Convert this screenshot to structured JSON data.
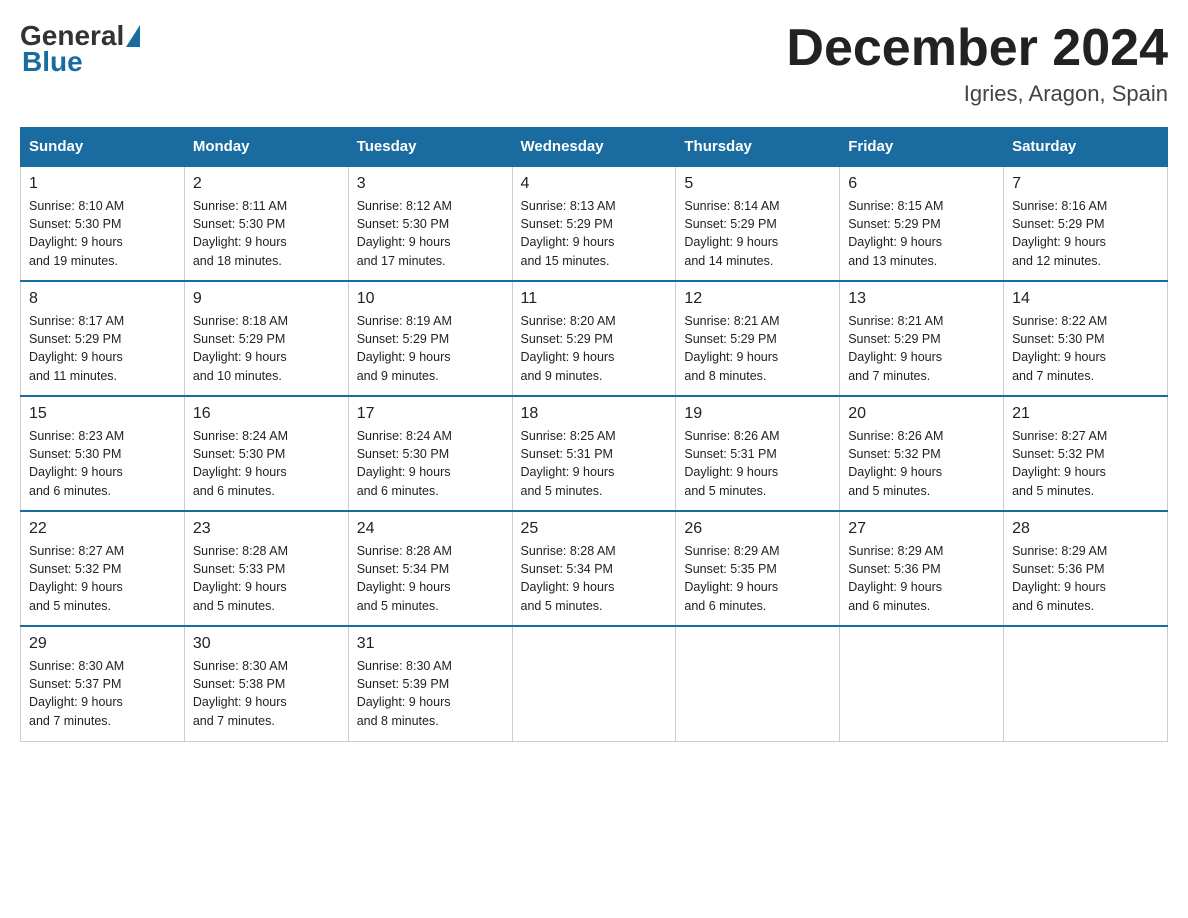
{
  "logo": {
    "general": "General",
    "blue": "Blue"
  },
  "header": {
    "month": "December 2024",
    "location": "Igries, Aragon, Spain"
  },
  "weekdays": [
    "Sunday",
    "Monday",
    "Tuesday",
    "Wednesday",
    "Thursday",
    "Friday",
    "Saturday"
  ],
  "weeks": [
    [
      {
        "day": "1",
        "sunrise": "8:10 AM",
        "sunset": "5:30 PM",
        "daylight": "9 hours and 19 minutes."
      },
      {
        "day": "2",
        "sunrise": "8:11 AM",
        "sunset": "5:30 PM",
        "daylight": "9 hours and 18 minutes."
      },
      {
        "day": "3",
        "sunrise": "8:12 AM",
        "sunset": "5:30 PM",
        "daylight": "9 hours and 17 minutes."
      },
      {
        "day": "4",
        "sunrise": "8:13 AM",
        "sunset": "5:29 PM",
        "daylight": "9 hours and 15 minutes."
      },
      {
        "day": "5",
        "sunrise": "8:14 AM",
        "sunset": "5:29 PM",
        "daylight": "9 hours and 14 minutes."
      },
      {
        "day": "6",
        "sunrise": "8:15 AM",
        "sunset": "5:29 PM",
        "daylight": "9 hours and 13 minutes."
      },
      {
        "day": "7",
        "sunrise": "8:16 AM",
        "sunset": "5:29 PM",
        "daylight": "9 hours and 12 minutes."
      }
    ],
    [
      {
        "day": "8",
        "sunrise": "8:17 AM",
        "sunset": "5:29 PM",
        "daylight": "9 hours and 11 minutes."
      },
      {
        "day": "9",
        "sunrise": "8:18 AM",
        "sunset": "5:29 PM",
        "daylight": "9 hours and 10 minutes."
      },
      {
        "day": "10",
        "sunrise": "8:19 AM",
        "sunset": "5:29 PM",
        "daylight": "9 hours and 9 minutes."
      },
      {
        "day": "11",
        "sunrise": "8:20 AM",
        "sunset": "5:29 PM",
        "daylight": "9 hours and 9 minutes."
      },
      {
        "day": "12",
        "sunrise": "8:21 AM",
        "sunset": "5:29 PM",
        "daylight": "9 hours and 8 minutes."
      },
      {
        "day": "13",
        "sunrise": "8:21 AM",
        "sunset": "5:29 PM",
        "daylight": "9 hours and 7 minutes."
      },
      {
        "day": "14",
        "sunrise": "8:22 AM",
        "sunset": "5:30 PM",
        "daylight": "9 hours and 7 minutes."
      }
    ],
    [
      {
        "day": "15",
        "sunrise": "8:23 AM",
        "sunset": "5:30 PM",
        "daylight": "9 hours and 6 minutes."
      },
      {
        "day": "16",
        "sunrise": "8:24 AM",
        "sunset": "5:30 PM",
        "daylight": "9 hours and 6 minutes."
      },
      {
        "day": "17",
        "sunrise": "8:24 AM",
        "sunset": "5:30 PM",
        "daylight": "9 hours and 6 minutes."
      },
      {
        "day": "18",
        "sunrise": "8:25 AM",
        "sunset": "5:31 PM",
        "daylight": "9 hours and 5 minutes."
      },
      {
        "day": "19",
        "sunrise": "8:26 AM",
        "sunset": "5:31 PM",
        "daylight": "9 hours and 5 minutes."
      },
      {
        "day": "20",
        "sunrise": "8:26 AM",
        "sunset": "5:32 PM",
        "daylight": "9 hours and 5 minutes."
      },
      {
        "day": "21",
        "sunrise": "8:27 AM",
        "sunset": "5:32 PM",
        "daylight": "9 hours and 5 minutes."
      }
    ],
    [
      {
        "day": "22",
        "sunrise": "8:27 AM",
        "sunset": "5:32 PM",
        "daylight": "9 hours and 5 minutes."
      },
      {
        "day": "23",
        "sunrise": "8:28 AM",
        "sunset": "5:33 PM",
        "daylight": "9 hours and 5 minutes."
      },
      {
        "day": "24",
        "sunrise": "8:28 AM",
        "sunset": "5:34 PM",
        "daylight": "9 hours and 5 minutes."
      },
      {
        "day": "25",
        "sunrise": "8:28 AM",
        "sunset": "5:34 PM",
        "daylight": "9 hours and 5 minutes."
      },
      {
        "day": "26",
        "sunrise": "8:29 AM",
        "sunset": "5:35 PM",
        "daylight": "9 hours and 6 minutes."
      },
      {
        "day": "27",
        "sunrise": "8:29 AM",
        "sunset": "5:36 PM",
        "daylight": "9 hours and 6 minutes."
      },
      {
        "day": "28",
        "sunrise": "8:29 AM",
        "sunset": "5:36 PM",
        "daylight": "9 hours and 6 minutes."
      }
    ],
    [
      {
        "day": "29",
        "sunrise": "8:30 AM",
        "sunset": "5:37 PM",
        "daylight": "9 hours and 7 minutes."
      },
      {
        "day": "30",
        "sunrise": "8:30 AM",
        "sunset": "5:38 PM",
        "daylight": "9 hours and 7 minutes."
      },
      {
        "day": "31",
        "sunrise": "8:30 AM",
        "sunset": "5:39 PM",
        "daylight": "9 hours and 8 minutes."
      },
      null,
      null,
      null,
      null
    ]
  ],
  "labels": {
    "sunrise": "Sunrise:",
    "sunset": "Sunset:",
    "daylight": "Daylight:"
  }
}
